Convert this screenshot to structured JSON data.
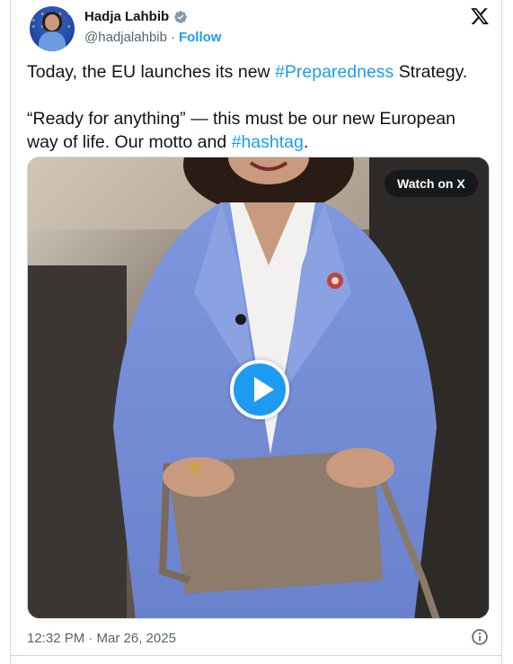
{
  "author": {
    "display_name": "Hadja Lahbib",
    "handle": "@hadjalahbib",
    "separator": "·",
    "follow_label": "Follow",
    "verified_icon": "verified-badge-icon"
  },
  "tweet": {
    "line1_before": "Today, the EU launches its new ",
    "line1_hashtag": "#Preparedness",
    "line1_after": " Strategy.",
    "line2_before": "“Ready for anything” — this must be our new European way of life. Our motto and ",
    "line2_hashtag": "#hashtag",
    "line2_after": "."
  },
  "media": {
    "watch_label": "Watch on X",
    "play_icon": "play-icon"
  },
  "footer": {
    "timestamp": "12:32 PM · Mar 26, 2025",
    "info_icon": "info-icon"
  },
  "colors": {
    "accent": "#1d9bf0",
    "text": "#0f1419",
    "secondary": "#536471",
    "border": "#cfd9de"
  }
}
